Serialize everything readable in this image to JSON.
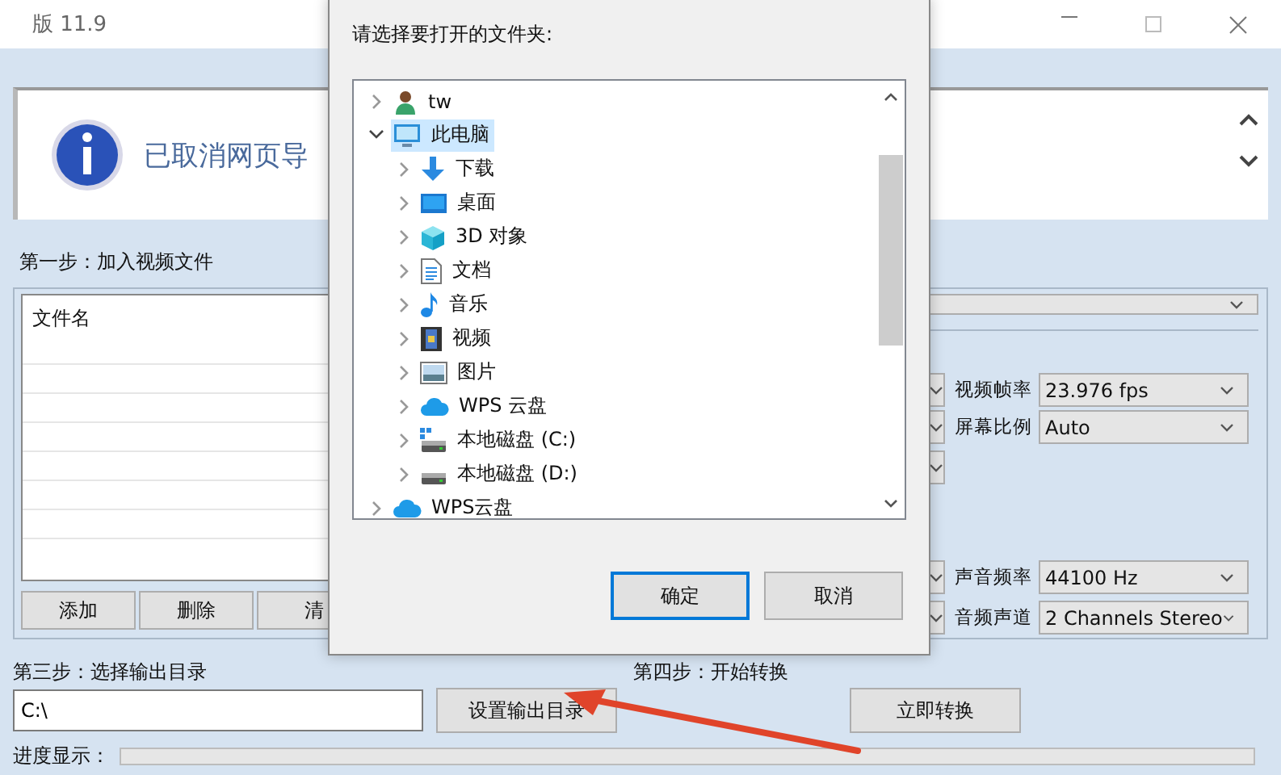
{
  "window": {
    "title": "版 11.9"
  },
  "notice": {
    "text": "已取消网页导"
  },
  "step1": {
    "label": "第一步：加入视频文件"
  },
  "file_list": {
    "column": "文件名"
  },
  "file_buttons": [
    "添加",
    "删除",
    "清"
  ],
  "settings": [
    {
      "label": "视频帧率",
      "value": "23.976 fps"
    },
    {
      "label": "屏幕比例",
      "value": "Auto"
    },
    {
      "label": "声音频率",
      "value": "44100 Hz"
    },
    {
      "label": "音频声道",
      "value": "2 Channels Stereo"
    }
  ],
  "step3": {
    "label": "第三步：选择输出目录",
    "path": "C:\\",
    "button": "设置输出目录"
  },
  "step4": {
    "label": "第四步：开始转换",
    "button": "立即转换"
  },
  "progress": {
    "label": "进度显示："
  },
  "dialog": {
    "prompt": "请选择要打开的文件夹:",
    "tree": [
      {
        "label": "tw",
        "kind": "user",
        "expanded": false,
        "selected": false
      },
      {
        "label": "此电脑",
        "kind": "computer",
        "expanded": true,
        "selected": true,
        "children": [
          {
            "label": "下载",
            "kind": "download",
            "expanded": false,
            "selected": false
          },
          {
            "label": "桌面",
            "kind": "desktop",
            "expanded": false,
            "selected": false
          },
          {
            "label": "3D 对象",
            "kind": "cube",
            "expanded": false,
            "selected": false
          },
          {
            "label": "文档",
            "kind": "document",
            "expanded": false,
            "selected": false
          },
          {
            "label": "音乐",
            "kind": "music",
            "expanded": false,
            "selected": false
          },
          {
            "label": "视频",
            "kind": "video",
            "expanded": false,
            "selected": false
          },
          {
            "label": "图片",
            "kind": "pictures",
            "expanded": false,
            "selected": false
          },
          {
            "label": "WPS 云盘",
            "kind": "cloud",
            "expanded": false,
            "selected": false
          },
          {
            "label": "本地磁盘 (C:)",
            "kind": "system-drive",
            "expanded": false,
            "selected": false
          },
          {
            "label": "本地磁盘 (D:)",
            "kind": "drive",
            "expanded": false,
            "selected": false
          }
        ]
      },
      {
        "label": "WPS云盘",
        "kind": "cloud",
        "expanded": false,
        "selected": false
      }
    ],
    "buttons": [
      {
        "label": "确定",
        "kind": "default"
      },
      {
        "label": "取消",
        "kind": "normal"
      }
    ]
  }
}
